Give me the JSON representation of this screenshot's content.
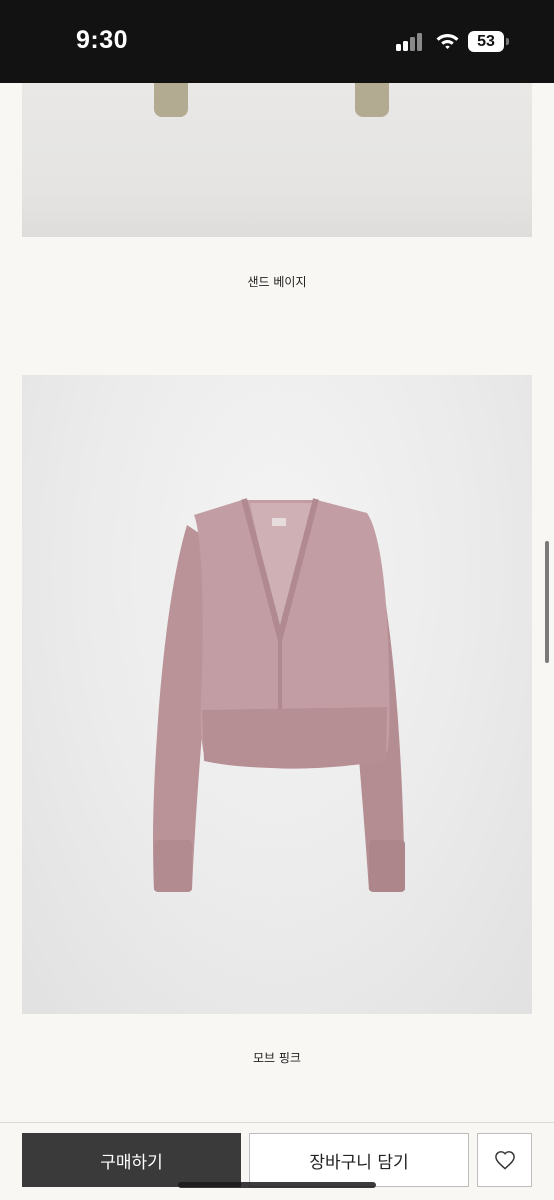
{
  "status_bar": {
    "time": "9:30",
    "battery": "53",
    "icons": [
      "signal-icon",
      "wifi-icon",
      "battery-icon"
    ]
  },
  "product_colors": [
    {
      "caption": "샌드 베이지",
      "swatch": "#b3aa92"
    },
    {
      "caption": "모브 핑크",
      "swatch": "#bf9ba2"
    }
  ],
  "actions": {
    "buy_label": "구매하기",
    "cart_label": "장바구니 담기",
    "wishlist_icon": "heart-icon"
  },
  "colors": {
    "status_bar_bg": "#121212",
    "page_bg": "#f8f7f3",
    "buy_button_bg": "#3a3a3a"
  }
}
